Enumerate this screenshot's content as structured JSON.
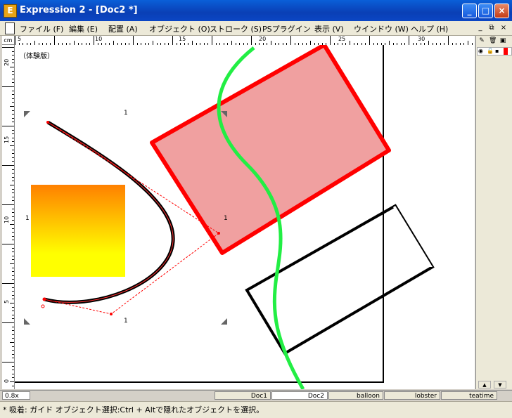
{
  "window": {
    "title": "Expression 2 - [Doc2 *]",
    "app_icon_letter": "E",
    "minimize": "_",
    "maximize": "□",
    "close": "×"
  },
  "menu": {
    "items": [
      "ファイル (F)",
      "編集 (E)",
      "配置 (A)",
      "オブジェクト (O)",
      "ストローク (S)",
      "PSプラグイン",
      "表示 (V)",
      "ウインドウ (W)",
      "ヘルプ (H)"
    ],
    "mdi_minimize": "_",
    "mdi_restore": "⧉",
    "mdi_close": "×"
  },
  "ruler": {
    "unit": "cm",
    "h_labels": [
      "5",
      "10",
      "15",
      "20",
      "25",
      "30"
    ],
    "v_labels": [
      "20",
      "15",
      "10",
      "5",
      "0"
    ]
  },
  "canvas": {
    "trial_label": "（体験版）",
    "handle_marks": [
      "1",
      "1",
      "1",
      "1"
    ]
  },
  "colors": {
    "title_bar": "#0a4fc8",
    "red_rect_fill": "#f0a0a0",
    "red_rect_stroke": "#ff0000",
    "green_curve": "#22ee44",
    "gradient_top": "#ff8000",
    "gradient_bottom": "#ffff00"
  },
  "tabs": {
    "zoom": "0.8x",
    "docs": [
      "Doc1",
      "Doc2",
      "balloon",
      "lobster",
      "teatime"
    ],
    "active": "Doc2"
  },
  "status": {
    "text": "* 吸着: ガイド     オブジェクト選択:Ctrl + Altで隠れたオブジェクトを選択。"
  }
}
